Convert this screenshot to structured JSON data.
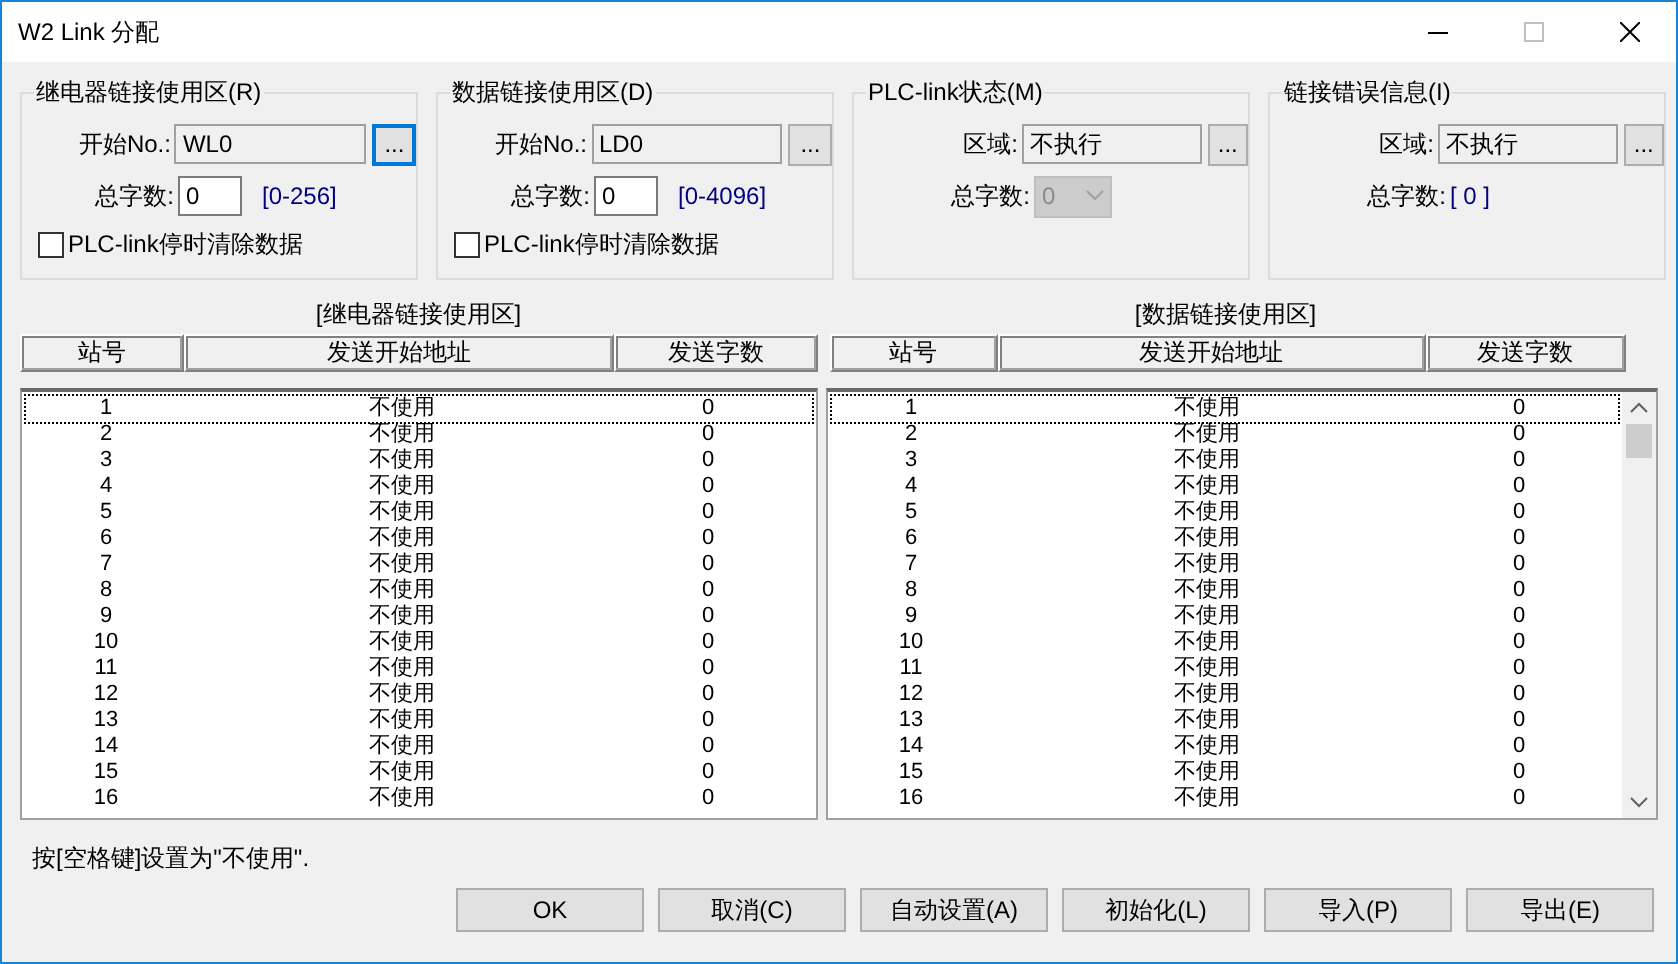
{
  "window": {
    "title": "W2 Link 分配"
  },
  "groups": [
    {
      "title": "继电器链接使用区(R)",
      "fields": [
        {
          "kind": "address",
          "label": "开始No.:",
          "value": "WL0",
          "button": "...",
          "focused": true
        },
        {
          "kind": "count",
          "label": "总字数:",
          "value": "0",
          "range": "[0-256]"
        },
        {
          "kind": "checkbox",
          "label": "PLC-link停时清除数据",
          "checked": false
        }
      ]
    },
    {
      "title": "数据链接使用区(D)",
      "fields": [
        {
          "kind": "address",
          "label": "开始No.:",
          "value": "LD0",
          "button": "...",
          "focused": false
        },
        {
          "kind": "count",
          "label": "总字数:",
          "value": "0",
          "range": "[0-4096]"
        },
        {
          "kind": "checkbox",
          "label": "PLC-link停时清除数据",
          "checked": false
        }
      ]
    },
    {
      "title": "PLC-link状态(M)",
      "fields": [
        {
          "kind": "address",
          "label": "区域:",
          "value": "不执行",
          "button": "...",
          "focused": false
        },
        {
          "kind": "dropdown",
          "label": "总字数:",
          "value": "0",
          "disabled": true
        }
      ]
    },
    {
      "title": "链接错误信息(I)",
      "fields": [
        {
          "kind": "address",
          "label": "区域:",
          "value": "不执行",
          "button": "...",
          "focused": false
        },
        {
          "kind": "readout",
          "label": "总字数:",
          "value": "[ 0 ]"
        }
      ]
    }
  ],
  "tables": [
    {
      "title": "[继电器链接使用区]",
      "columns": [
        "站号",
        "发送开始地址",
        "发送字数"
      ],
      "rows": [
        {
          "station": "1",
          "address": "不使用",
          "count": "0",
          "focused": true
        },
        {
          "station": "2",
          "address": "不使用",
          "count": "0",
          "focused": false
        },
        {
          "station": "3",
          "address": "不使用",
          "count": "0",
          "focused": false
        },
        {
          "station": "4",
          "address": "不使用",
          "count": "0",
          "focused": false
        },
        {
          "station": "5",
          "address": "不使用",
          "count": "0",
          "focused": false
        },
        {
          "station": "6",
          "address": "不使用",
          "count": "0",
          "focused": false
        },
        {
          "station": "7",
          "address": "不使用",
          "count": "0",
          "focused": false
        },
        {
          "station": "8",
          "address": "不使用",
          "count": "0",
          "focused": false
        },
        {
          "station": "9",
          "address": "不使用",
          "count": "0",
          "focused": false
        },
        {
          "station": "10",
          "address": "不使用",
          "count": "0",
          "focused": false
        },
        {
          "station": "11",
          "address": "不使用",
          "count": "0",
          "focused": false
        },
        {
          "station": "12",
          "address": "不使用",
          "count": "0",
          "focused": false
        },
        {
          "station": "13",
          "address": "不使用",
          "count": "0",
          "focused": false
        },
        {
          "station": "14",
          "address": "不使用",
          "count": "0",
          "focused": false
        },
        {
          "station": "15",
          "address": "不使用",
          "count": "0",
          "focused": false
        },
        {
          "station": "16",
          "address": "不使用",
          "count": "0",
          "focused": false
        }
      ]
    },
    {
      "title": "[数据链接使用区]",
      "columns": [
        "站号",
        "发送开始地址",
        "发送字数"
      ],
      "rows": [
        {
          "station": "1",
          "address": "不使用",
          "count": "0",
          "focused": true
        },
        {
          "station": "2",
          "address": "不使用",
          "count": "0",
          "focused": false
        },
        {
          "station": "3",
          "address": "不使用",
          "count": "0",
          "focused": false
        },
        {
          "station": "4",
          "address": "不使用",
          "count": "0",
          "focused": false
        },
        {
          "station": "5",
          "address": "不使用",
          "count": "0",
          "focused": false
        },
        {
          "station": "6",
          "address": "不使用",
          "count": "0",
          "focused": false
        },
        {
          "station": "7",
          "address": "不使用",
          "count": "0",
          "focused": false
        },
        {
          "station": "8",
          "address": "不使用",
          "count": "0",
          "focused": false
        },
        {
          "station": "9",
          "address": "不使用",
          "count": "0",
          "focused": false
        },
        {
          "station": "10",
          "address": "不使用",
          "count": "0",
          "focused": false
        },
        {
          "station": "11",
          "address": "不使用",
          "count": "0",
          "focused": false
        },
        {
          "station": "12",
          "address": "不使用",
          "count": "0",
          "focused": false
        },
        {
          "station": "13",
          "address": "不使用",
          "count": "0",
          "focused": false
        },
        {
          "station": "14",
          "address": "不使用",
          "count": "0",
          "focused": false
        },
        {
          "station": "15",
          "address": "不使用",
          "count": "0",
          "focused": false
        },
        {
          "station": "16",
          "address": "不使用",
          "count": "0",
          "focused": false
        }
      ]
    }
  ],
  "status": "按[空格键]设置为\"不使用\".",
  "buttons": [
    "OK",
    "取消(C)",
    "自动设置(A)",
    "初始化(L)",
    "导入(P)",
    "导出(E)"
  ]
}
